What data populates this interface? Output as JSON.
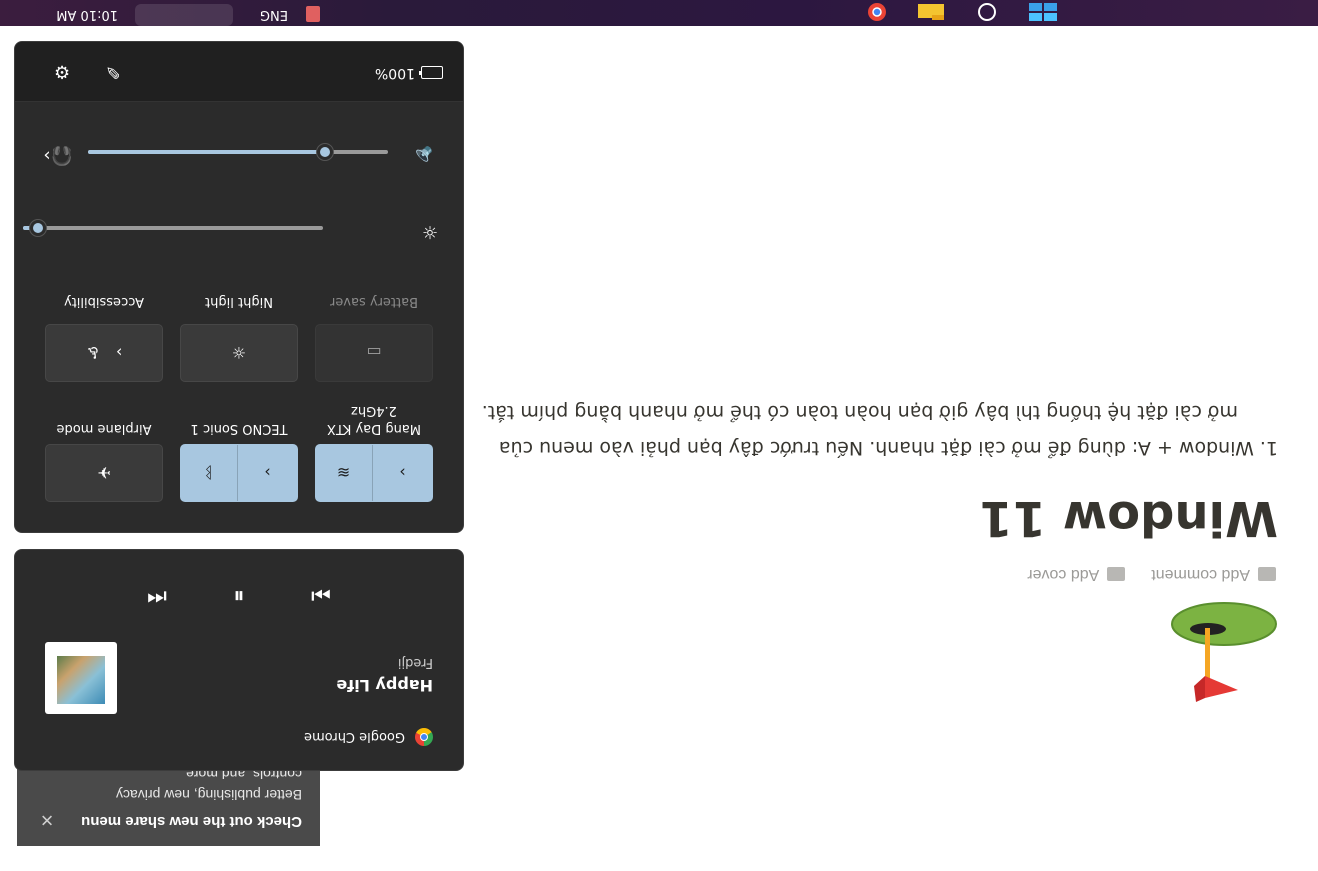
{
  "taskbar": {
    "time": "10:10 AM",
    "lang": "ENG",
    "icons": [
      "windows-start-icon",
      "search-icon",
      "file-explorer-icon",
      "chrome-icon"
    ]
  },
  "page": {
    "title": "Window 11",
    "actions": {
      "add_cover": "Add cover",
      "add_comment": "Add comment"
    },
    "body_line1": "1.  Window + A: dùng để mở cài đặt nhanh. Nếu trước đây bạn phải vào menu của",
    "body_line2": "mở cài đặt hệ thống thì bây giờ bạn hoàn toàn có thể mở nhanh bằng phím tắt."
  },
  "toast": {
    "title": "Check out the new share menu",
    "body": "Better publishing, new privacy controls, and more",
    "close": "×"
  },
  "media": {
    "source": "Google Chrome",
    "song": "Happy Life",
    "artist": "Fredji",
    "art_caption": "HAPPY LIFE",
    "controls": {
      "prev": "⏮",
      "pause": "⏸",
      "next": "⏭"
    }
  },
  "quick_settings": {
    "tiles": [
      {
        "label": "Mang Day KTX 2.4Ghz",
        "state": "on",
        "icon": "wifi-icon"
      },
      {
        "label": "TECNO Sonic 1",
        "state": "on",
        "icon": "bluetooth-icon"
      },
      {
        "label": "Airplane mode",
        "state": "off",
        "icon": "airplane-icon"
      },
      {
        "label": "Battery saver",
        "state": "disabled",
        "icon": "battery-saver-icon"
      },
      {
        "label": "Night light",
        "state": "off",
        "icon": "night-light-icon"
      },
      {
        "label": "Accessibility",
        "state": "off",
        "icon": "accessibility-icon"
      }
    ],
    "brightness": 0.05,
    "volume": 0.79,
    "battery": "100%"
  },
  "colors": {
    "accent": "#a8c7e0",
    "flyout_bg": "#2b2b2b",
    "taskbar_bg": "#2c1740",
    "page_text": "#37352f"
  }
}
